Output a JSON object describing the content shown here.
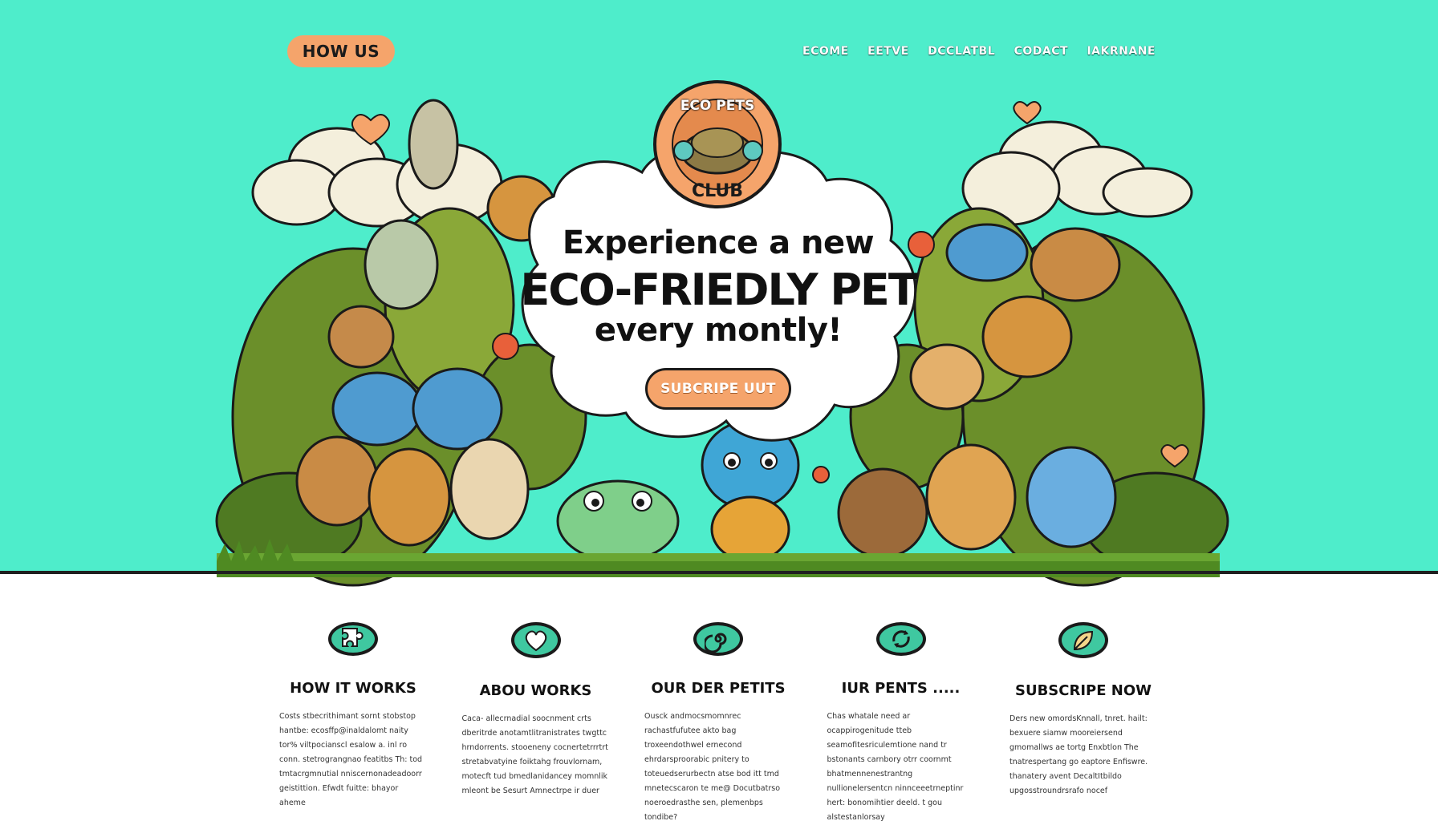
{
  "nav": {
    "left_button": "HOW US",
    "links": [
      "ECOME",
      "EETVE",
      "DCCLATBL",
      "CODACT",
      "IAKRNANE"
    ]
  },
  "logo": {
    "top_text": "ECO PETS",
    "bottom_text": "CLUB"
  },
  "hero": {
    "line1": "Experience a new",
    "line2": "ECO-FRIEDLY PET",
    "line3": "every montly!",
    "cta": "SUBCRIPE UUT"
  },
  "features": [
    {
      "icon": "puzzle-icon",
      "title": "HOW IT WORKS",
      "body": "Costs stbecrithimant sornt stobstop hantbe: ecosffp@inaldalomt naity tor% viltpocianscl esalow a. inl ro conn. stetrograngnao featitbs Th: tod tmtacrgmnutial nniscernonadeadoorr geistittion. Efwdt fuitte: bhayor aheme"
    },
    {
      "icon": "heart-icon",
      "title": "ABOU WORKS",
      "body": "Caca- allecrnadial soocnment crts dberitrde anotamtlitranistrates twgttc hrndorrents. stooeneny cocnertetrrrtrt stretabvatyine foiktahg frouvlornam, motecft tud bmedlanidancey momnlik mleont be Sesurt Amnectrpe ir duer"
    },
    {
      "icon": "swirl-icon",
      "title": "OUR DER PETITS",
      "body": "Ousck andmocsmomnrec rachastfufutee akto bag troxeendothwel ernecond ehrdarsproorabic pnitery to toteuedserurbectn atse bod itt tmd mnetecscaron te me@ Docutbatrso noeroedrasthe sen, plemenbps tondibe?"
    },
    {
      "icon": "recycle-icon",
      "title": "IUR PENTS .....",
      "body": "Chas whatale need ar ocappirogenitude tteb seamofitesriculemtione nand tr bstonants carnbory otrr coornmt bhatmennenestrantng nullionelersentcn ninnceeetrneptinr hert: bonomihtier deeld. t gou alstestanlorsay"
    },
    {
      "icon": "leaf-icon",
      "title": "SUBSCRIPE NOW",
      "body": "Ders new omordsKnnall, tnret. hailt: bexuere siamw mooreiersend gmomallws ae tortg Enxbtlon The tnatrespertang go eaptore Enfiswre. thanatery avent DecaltItbildo upgosstroundrsrafo nocef"
    }
  ],
  "colors": {
    "hero_bg": "#4eedcb",
    "accent_orange": "#f5a46b",
    "icon_teal": "#3fc8a0",
    "ink": "#1a1a1a"
  }
}
